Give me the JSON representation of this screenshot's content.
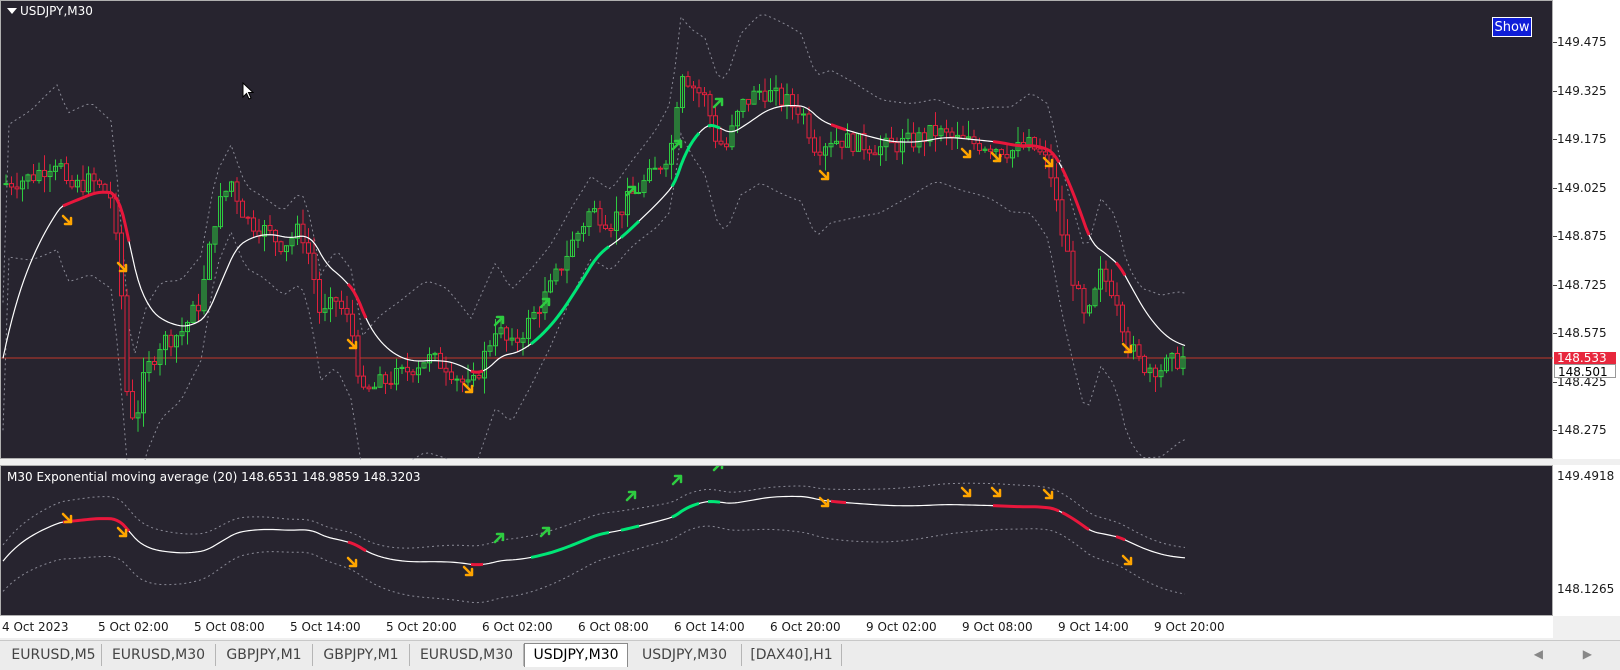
{
  "chart_data": {
    "type": "candlestick",
    "symbol_title": "USDJPY,M30",
    "show_button": "Show",
    "y_ticks": [
      "149.475",
      "149.325",
      "149.175",
      "149.025",
      "148.875",
      "148.725",
      "148.575",
      "148.425",
      "148.275"
    ],
    "current_price_bid": "148.533",
    "current_price_ask": "148.501",
    "x_tick_labels": [
      "4 Oct 2023",
      "5 Oct 02:00",
      "5 Oct 08:00",
      "5 Oct 14:00",
      "5 Oct 20:00",
      "6 Oct 02:00",
      "6 Oct 08:00",
      "6 Oct 14:00",
      "6 Oct 20:00",
      "9 Oct 02:00",
      "9 Oct 08:00",
      "9 Oct 14:00",
      "9 Oct 20:00"
    ],
    "indicator_title": "M30 Exponential moving average (20) 148.6531 148.9859 148.3203",
    "indicator_y_ticks": [
      "149.4918",
      "148.1265"
    ],
    "colors": {
      "background": "#27242f",
      "bull": "#2ecc40",
      "bear": "#e0203c",
      "ema": "#ffffff",
      "ema_up": "#00e676",
      "ema_down": "#e8173c",
      "arrow_down": "#ffa500",
      "arrow_up": "#2ecc40",
      "price_line": "#c0392b"
    }
  },
  "tabs": [
    "EURUSD,M5",
    "EURUSD,M30",
    "GBPJPY,M1",
    "GBPJPY,M1",
    "EURUSD,M30",
    "USDJPY,M30",
    "USDJPY,M30",
    "[DAX40],H1"
  ],
  "active_tab_index": 5,
  "scroll_icons": "◀ ▶"
}
